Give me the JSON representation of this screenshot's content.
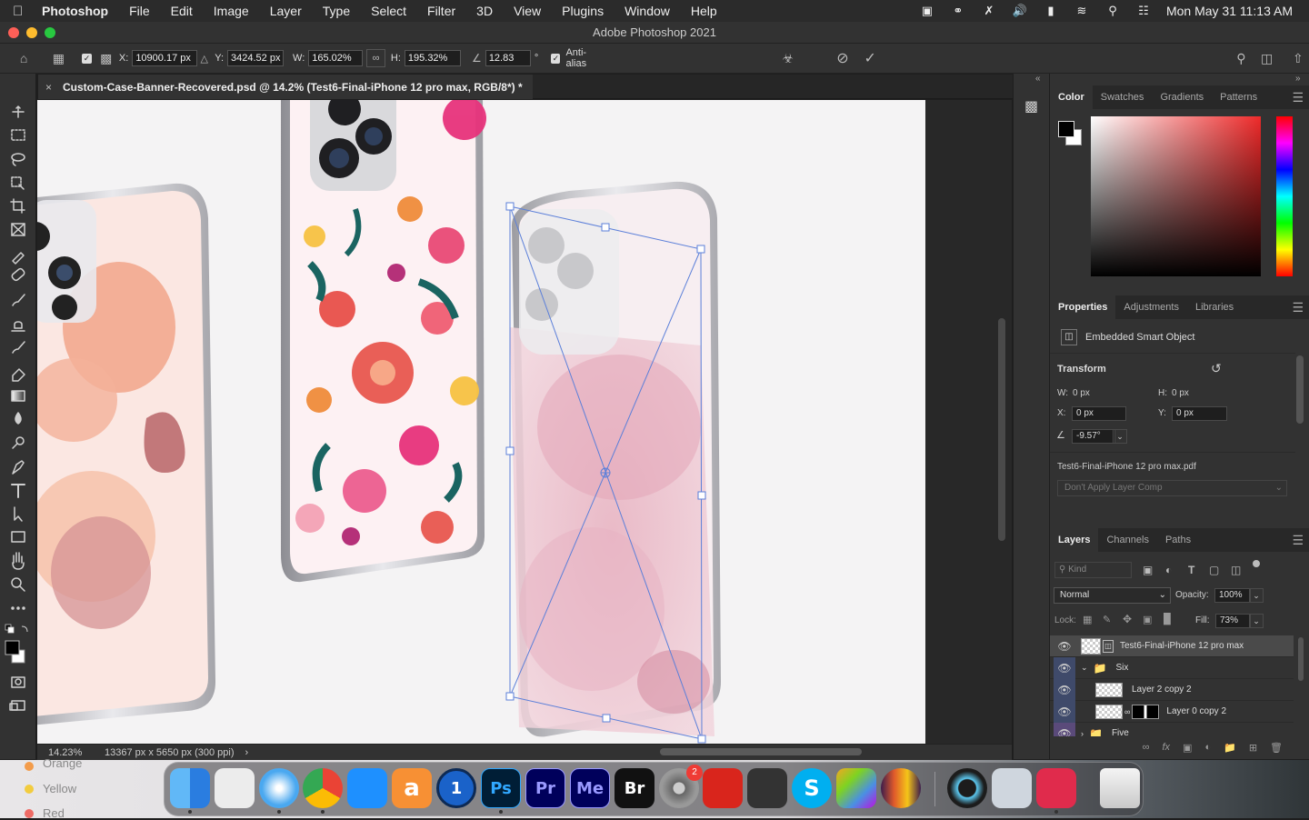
{
  "menubar": {
    "app": "Photoshop",
    "items": [
      "File",
      "Edit",
      "Image",
      "Layer",
      "Type",
      "Select",
      "Filter",
      "3D",
      "View",
      "Plugins",
      "Window",
      "Help"
    ],
    "clock": "Mon May 31  11:13 AM"
  },
  "window": {
    "title": "Adobe Photoshop 2021"
  },
  "options": {
    "x_label": "X:",
    "x_value": "10900.17 px",
    "y_label": "Y:",
    "y_value": "3424.52 px",
    "w_label": "W:",
    "w_value": "165.02%",
    "h_label": "H:",
    "h_value": "195.32%",
    "angle_value": "12.83",
    "degree_symbol": "°",
    "antialias_label": "Anti-alias"
  },
  "document": {
    "tab_title": "Custom-Case-Banner-Recovered.psd @ 14.2% (Test6-Final-iPhone 12 pro max, RGB/8*) *",
    "zoom": "14.23%",
    "dimensions": "13367 px x 5650 px (300 ppi)"
  },
  "color_panel": {
    "tabs": [
      "Color",
      "Swatches",
      "Gradients",
      "Patterns"
    ],
    "foreground": "#000000",
    "background": "#ffffff",
    "hue_color": "#ee2a2a"
  },
  "properties_panel": {
    "tabs": [
      "Properties",
      "Adjustments",
      "Libraries"
    ],
    "object_type": "Embedded Smart Object",
    "section": "Transform",
    "w_label": "W:",
    "w_value": "0 px",
    "h_label": "H:",
    "h_value": "0 px",
    "x_label": "X:",
    "x_value": "0 px",
    "y_label": "Y:",
    "y_value": "0 px",
    "angle_value": "-9.57°",
    "source_file": "Test6-Final-iPhone 12 pro max.pdf",
    "layer_comp": "Don't Apply Layer Comp"
  },
  "layers_panel": {
    "tabs": [
      "Layers",
      "Channels",
      "Paths"
    ],
    "filter_placeholder": "Kind",
    "blend_mode": "Normal",
    "opacity_label": "Opacity:",
    "opacity_value": "100%",
    "lock_label": "Lock:",
    "fill_label": "Fill:",
    "fill_value": "73%",
    "layers": [
      {
        "name": "Test6-Final-iPhone 12 pro max",
        "type": "smart-object",
        "selected": true
      },
      {
        "name": "Six",
        "type": "group",
        "expanded": true
      },
      {
        "name": "Layer 2 copy 2",
        "type": "pixel"
      },
      {
        "name": "Layer 0 copy 2",
        "type": "pixel-with-mask"
      },
      {
        "name": "Five",
        "type": "group",
        "expanded": false
      }
    ]
  },
  "desktop": {
    "sidebar_items": [
      {
        "label": "Orange",
        "color": "#f39c4b"
      },
      {
        "label": "Yellow",
        "color": "#f2cc3f"
      },
      {
        "label": "Red",
        "color": "#ef6b65"
      }
    ]
  },
  "dock": {
    "apps": [
      {
        "name": "Finder",
        "icon": "finder-icon",
        "color": "#3a8ee6",
        "label": ""
      },
      {
        "name": "Launchpad",
        "icon": "launchpad-icon",
        "color": "#ececec",
        "label": ""
      },
      {
        "name": "Safari",
        "icon": "safari-icon",
        "color": "#4aa8f0",
        "label": ""
      },
      {
        "name": "Chrome",
        "icon": "chrome-icon",
        "color": "#ffffff",
        "label": ""
      },
      {
        "name": "App Store",
        "icon": "app-store-icon",
        "color": "#1e90ff",
        "label": ""
      },
      {
        "name": "Amazon",
        "icon": "amazon-icon",
        "color": "#f79034",
        "label": "a"
      },
      {
        "name": "1Password",
        "icon": "1password-icon",
        "color": "#1a62c9",
        "label": "1"
      },
      {
        "name": "Photoshop",
        "icon": "photoshop-icon",
        "color": "#001e36",
        "label": "Ps"
      },
      {
        "name": "Premiere Pro",
        "icon": "premiere-icon",
        "color": "#00005b",
        "label": "Pr"
      },
      {
        "name": "Media Encoder",
        "icon": "media-encoder-icon",
        "color": "#00005b",
        "label": "Me"
      },
      {
        "name": "Bridge",
        "icon": "bridge-icon",
        "color": "#111111",
        "label": "Br"
      },
      {
        "name": "System Preferences",
        "icon": "system-preferences-icon",
        "color": "#8a8a8a",
        "label": ""
      },
      {
        "name": "Acrobat",
        "icon": "acrobat-icon",
        "color": "#d9251c",
        "label": ""
      },
      {
        "name": "Calculator",
        "icon": "calculator-icon",
        "color": "#333333",
        "label": ""
      },
      {
        "name": "Skype",
        "icon": "skype-icon",
        "color": "#00aff0",
        "label": "S"
      },
      {
        "name": "Final Cut Pro",
        "icon": "final-cut-icon",
        "color": "#222222",
        "label": ""
      },
      {
        "name": "Audition",
        "icon": "audition-icon",
        "color": "#3c1c4c",
        "label": ""
      },
      {
        "name": "QuickTime",
        "icon": "quicktime-icon",
        "color": "#1c1c1c",
        "label": ""
      },
      {
        "name": "Preview",
        "icon": "preview-icon",
        "color": "#cfd6de",
        "label": ""
      },
      {
        "name": "Creative Cloud",
        "icon": "creative-cloud-icon",
        "color": "#e02b4c",
        "label": ""
      },
      {
        "name": "Trash",
        "icon": "trash-icon",
        "color": "#d8d8d8",
        "label": ""
      }
    ],
    "system_preferences_badge": "2"
  }
}
